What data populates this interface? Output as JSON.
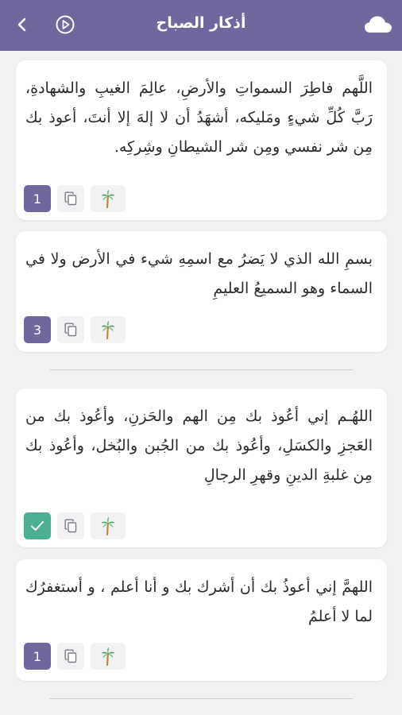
{
  "header": {
    "title": "أذكار الصباح"
  },
  "cards": [
    {
      "text": "اللَّهم فاطِرَ السمواتِ والأرضِ، عالِمَ الغيبِ والشهادةِ، رَبَّ كُلِّ شيءٍ ومَليكه، أشهَدُ أن لا إلهَ إلا أنتَ، أعوذ بك مِن شر نفسي ومِن شر الشيطانِ وشِركِه.",
      "count": "1"
    },
    {
      "text": "بسمِ الله الذي لا يَضرُ مع اسمِهِ شيء في الأرض ولا في السماء وهو السميعُ العليمِ",
      "count": "3"
    },
    {
      "text": "اللهُـم إني أعُوذ بك مِن الهم والحَزنِ، وأعُوذ بك من العَجزِ والكسَلِ، وأعُوذ بك من الجُبن والبُخل، وأعُوذ بك مِن غلبةِ الدينِ وقهرِ الرجالِ",
      "count": ""
    },
    {
      "text": "اللهمَّ إني أعوذُ بك أن أشرك بك و أنا أعلم ، و أستغفرُك لما لا أعلمُ",
      "count": "1"
    }
  ],
  "colors": {
    "header": "#6f689e",
    "counter": "#6f689e",
    "done": "#4caf94",
    "background": "#f1f1f2"
  },
  "icons": {
    "back": "chevron-left-icon",
    "play": "play-circle-icon",
    "cloud": "cloud-icon",
    "copy": "copy-icon",
    "palm": "palm-tree-icon",
    "check": "check-icon"
  }
}
